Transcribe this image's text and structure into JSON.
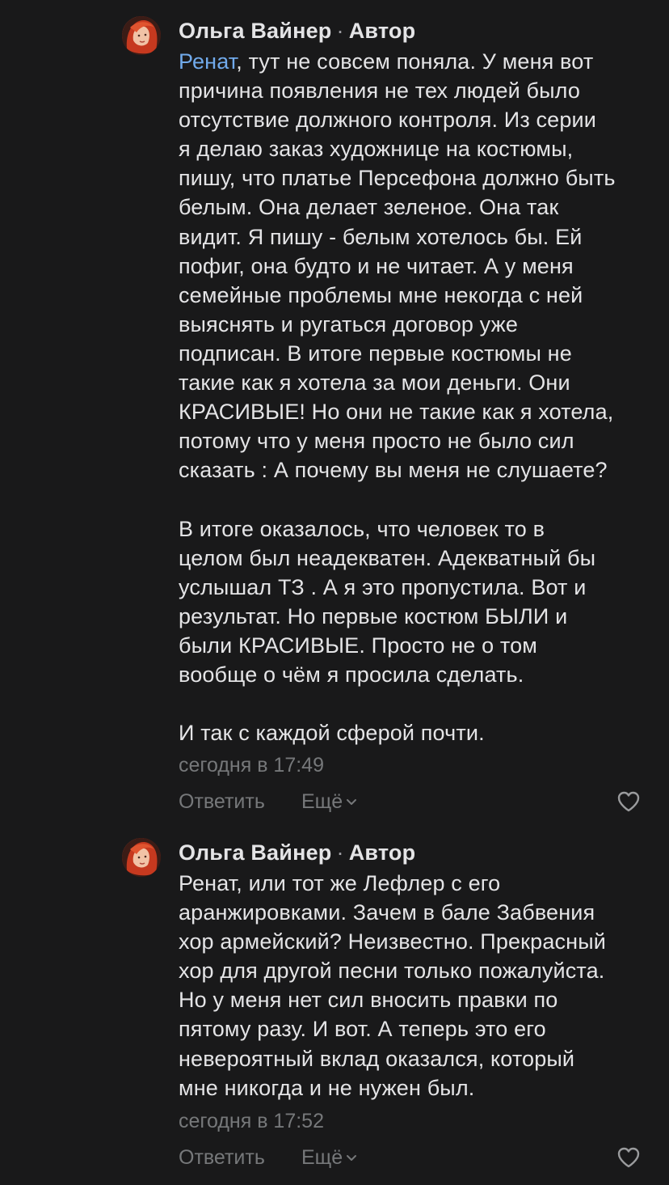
{
  "colors": {
    "background": "#19191a",
    "text": "#e4e4e6",
    "muted": "#76787a",
    "mention": "#71aaeb"
  },
  "comments": [
    {
      "author": "Ольга Вайнер",
      "badge": "Автор",
      "separator": "·",
      "mention": "Ренат",
      "first_line_rest": ", тут не совсем поняла. У меня вот",
      "lines": [
        "причина появления не тех людей было",
        "отсутствие должного контроля. Из серии",
        "я делаю заказ художнице на костюмы,",
        "пишу, что платье Персефона должно быть",
        "белым. Она делает зеленое. Она так",
        "видит. Я пишу - белым хотелось бы. Ей",
        "пофиг, она будто и не читает. А у меня",
        "семейные проблемы мне некогда с ней",
        "выяснять и ругаться договор уже",
        "подписан. В итоге первые костюмы не",
        "такие как я хотела за мои деньги. Они",
        "КРАСИВЫЕ! Но они не такие как я хотела,",
        "потому что у меня просто не было сил",
        "сказать : А почему вы меня не слушаете?",
        "",
        "В итоге оказалось, что человек то в",
        "целом был неадекватен. Адекватный бы",
        "услышал ТЗ . А я это пропустила. Вот и",
        "результат. Но первые костюм БЫЛИ и",
        "были КРАСИВЫЕ. Просто не о том",
        "вообще о чём я просила сделать.",
        "",
        "И так с каждой сферой почти."
      ],
      "time": "сегодня в 17:49",
      "reply_label": "Ответить",
      "more_label": "Ещё",
      "avatar_icon": "avatar-icon",
      "like_icon": "heart-icon"
    },
    {
      "author": "Ольга Вайнер",
      "badge": "Автор",
      "separator": "·",
      "lines": [
        "Ренат, или тот же Лефлер с его",
        "аранжировками. Зачем в бале Забвения",
        "хор армейский? Неизвестно. Прекрасный",
        "хор для другой песни только пожалуйста.",
        "Но у меня нет сил вносить правки по",
        "пятому разу. И вот. А теперь это его",
        "невероятный вклад оказался, который",
        "мне никогда и не нужен был."
      ],
      "time": "сегодня в 17:52",
      "reply_label": "Ответить",
      "more_label": "Ещё",
      "avatar_icon": "avatar-icon",
      "like_icon": "heart-icon"
    }
  ]
}
